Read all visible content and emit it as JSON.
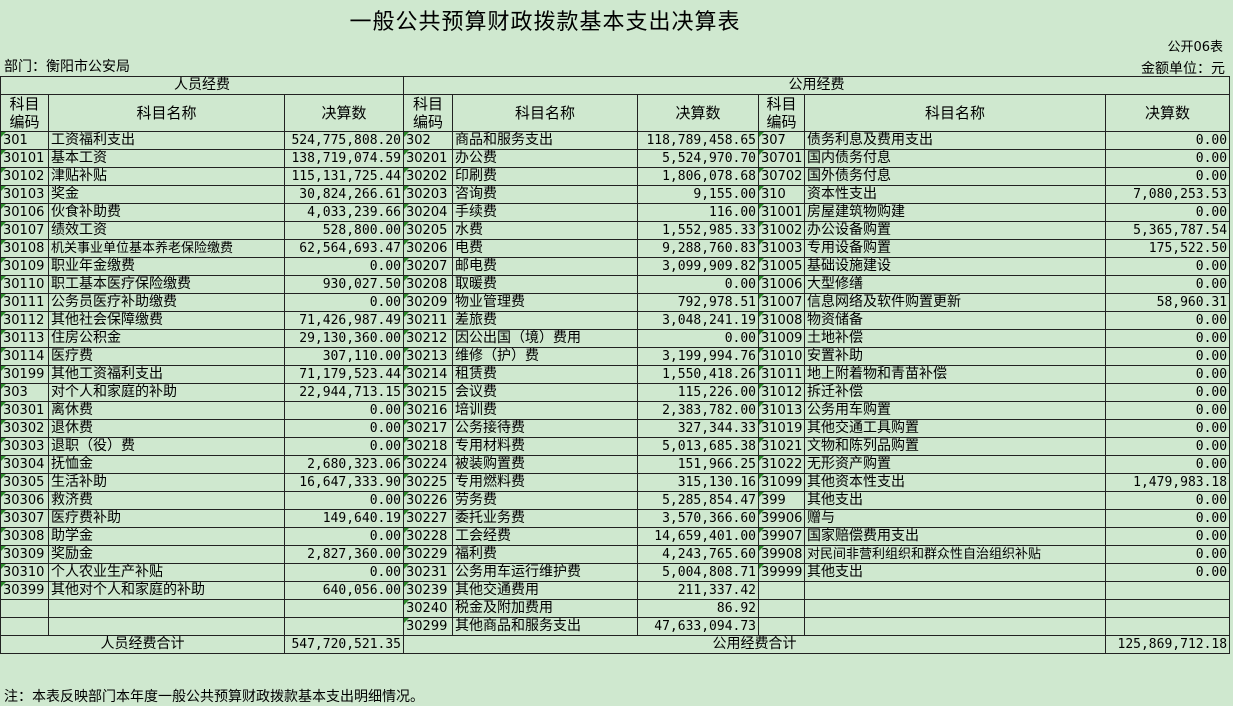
{
  "header": {
    "title": "一般公共预算财政拨款基本支出决算表",
    "form_no": "公开06表",
    "department": "部门：衡阳市公安局",
    "unit": "金额单位：元"
  },
  "sections": {
    "personnel": "人员经费",
    "public": "公用经费"
  },
  "columns": {
    "code": "科目编码",
    "name": "科目名称",
    "amount": "决算数"
  },
  "rows": [
    {
      "p": [
        "301",
        "工资福利支出",
        "524,775,808.20"
      ],
      "g": [
        "302",
        "商品和服务支出",
        "118,789,458.65"
      ],
      "r": [
        "307",
        "债务利息及费用支出",
        "0.00"
      ]
    },
    {
      "p": [
        "30101",
        "基本工资",
        "138,719,074.59"
      ],
      "g": [
        "30201",
        "办公费",
        "5,524,970.70"
      ],
      "r": [
        "30701",
        "国内债务付息",
        "0.00"
      ]
    },
    {
      "p": [
        "30102",
        "津贴补贴",
        "115,131,725.44"
      ],
      "g": [
        "30202",
        "印刷费",
        "1,806,078.68"
      ],
      "r": [
        "30702",
        "国外债务付息",
        "0.00"
      ]
    },
    {
      "p": [
        "30103",
        "奖金",
        "30,824,266.61"
      ],
      "g": [
        "30203",
        "咨询费",
        "9,155.00"
      ],
      "r": [
        "310",
        "资本性支出",
        "7,080,253.53"
      ]
    },
    {
      "p": [
        "30106",
        "伙食补助费",
        "4,033,239.66"
      ],
      "g": [
        "30204",
        "手续费",
        "116.00"
      ],
      "r": [
        "31001",
        "房屋建筑物购建",
        "0.00"
      ]
    },
    {
      "p": [
        "30107",
        "绩效工资",
        "528,800.00"
      ],
      "g": [
        "30205",
        "水费",
        "1,552,985.33"
      ],
      "r": [
        "31002",
        "办公设备购置",
        "5,365,787.54"
      ]
    },
    {
      "p": [
        "30108",
        "机关事业单位基本养老保险缴费",
        "62,564,693.47"
      ],
      "g": [
        "30206",
        "电费",
        "9,288,760.83"
      ],
      "r": [
        "31003",
        "专用设备购置",
        "175,522.50"
      ]
    },
    {
      "p": [
        "30109",
        "职业年金缴费",
        "0.00"
      ],
      "g": [
        "30207",
        "邮电费",
        "3,099,909.82"
      ],
      "r": [
        "31005",
        "基础设施建设",
        "0.00"
      ]
    },
    {
      "p": [
        "30110",
        "职工基本医疗保险缴费",
        "930,027.50"
      ],
      "g": [
        "30208",
        "取暖费",
        "0.00"
      ],
      "r": [
        "31006",
        "大型修缮",
        "0.00"
      ]
    },
    {
      "p": [
        "30111",
        "公务员医疗补助缴费",
        "0.00"
      ],
      "g": [
        "30209",
        "物业管理费",
        "792,978.51"
      ],
      "r": [
        "31007",
        "信息网络及软件购置更新",
        "58,960.31"
      ]
    },
    {
      "p": [
        "30112",
        "其他社会保障缴费",
        "71,426,987.49"
      ],
      "g": [
        "30211",
        "差旅费",
        "3,048,241.19"
      ],
      "r": [
        "31008",
        "物资储备",
        "0.00"
      ]
    },
    {
      "p": [
        "30113",
        "住房公积金",
        "29,130,360.00"
      ],
      "g": [
        "30212",
        "因公出国（境）费用",
        "0.00"
      ],
      "r": [
        "31009",
        "土地补偿",
        "0.00"
      ]
    },
    {
      "p": [
        "30114",
        "医疗费",
        "307,110.00"
      ],
      "g": [
        "30213",
        "维修（护）费",
        "3,199,994.76"
      ],
      "r": [
        "31010",
        "安置补助",
        "0.00"
      ]
    },
    {
      "p": [
        "30199",
        "其他工资福利支出",
        "71,179,523.44"
      ],
      "g": [
        "30214",
        "租赁费",
        "1,550,418.26"
      ],
      "r": [
        "31011",
        "地上附着物和青苗补偿",
        "0.00"
      ]
    },
    {
      "p": [
        "303",
        "对个人和家庭的补助",
        "22,944,713.15"
      ],
      "g": [
        "30215",
        "会议费",
        "115,226.00"
      ],
      "r": [
        "31012",
        "拆迁补偿",
        "0.00"
      ]
    },
    {
      "p": [
        "30301",
        "离休费",
        "0.00"
      ],
      "g": [
        "30216",
        "培训费",
        "2,383,782.00"
      ],
      "r": [
        "31013",
        "公务用车购置",
        "0.00"
      ]
    },
    {
      "p": [
        "30302",
        "退休费",
        "0.00"
      ],
      "g": [
        "30217",
        "公务接待费",
        "327,344.33"
      ],
      "r": [
        "31019",
        "其他交通工具购置",
        "0.00"
      ]
    },
    {
      "p": [
        "30303",
        "退职（役）费",
        "0.00"
      ],
      "g": [
        "30218",
        "专用材料费",
        "5,013,685.38"
      ],
      "r": [
        "31021",
        "文物和陈列品购置",
        "0.00"
      ]
    },
    {
      "p": [
        "30304",
        "抚恤金",
        "2,680,323.06"
      ],
      "g": [
        "30224",
        "被装购置费",
        "151,966.25"
      ],
      "r": [
        "31022",
        "无形资产购置",
        "0.00"
      ]
    },
    {
      "p": [
        "30305",
        "生活补助",
        "16,647,333.90"
      ],
      "g": [
        "30225",
        "专用燃料费",
        "315,130.16"
      ],
      "r": [
        "31099",
        "其他资本性支出",
        "1,479,983.18"
      ]
    },
    {
      "p": [
        "30306",
        "救济费",
        "0.00"
      ],
      "g": [
        "30226",
        "劳务费",
        "5,285,854.47"
      ],
      "r": [
        "399",
        "其他支出",
        "0.00"
      ]
    },
    {
      "p": [
        "30307",
        "医疗费补助",
        "149,640.19"
      ],
      "g": [
        "30227",
        "委托业务费",
        "3,570,366.60"
      ],
      "r": [
        "39906",
        "赠与",
        "0.00"
      ]
    },
    {
      "p": [
        "30308",
        "助学金",
        "0.00"
      ],
      "g": [
        "30228",
        "工会经费",
        "14,659,401.00"
      ],
      "r": [
        "39907",
        "国家赔偿费用支出",
        "0.00"
      ]
    },
    {
      "p": [
        "30309",
        "奖励金",
        "2,827,360.00"
      ],
      "g": [
        "30229",
        "福利费",
        "4,243,765.60"
      ],
      "r": [
        "39908",
        "对民间非营利组织和群众性自治组织补贴",
        "0.00"
      ]
    },
    {
      "p": [
        "30310",
        "个人农业生产补贴",
        "0.00"
      ],
      "g": [
        "30231",
        "公务用车运行维护费",
        "5,004,808.71"
      ],
      "r": [
        "39999",
        "其他支出",
        "0.00"
      ]
    },
    {
      "p": [
        "30399",
        "其他对个人和家庭的补助",
        "640,056.00"
      ],
      "g": [
        "30239",
        "其他交通费用",
        "211,337.42"
      ],
      "r": [
        "",
        "",
        ""
      ]
    },
    {
      "p": [
        "",
        "",
        ""
      ],
      "g": [
        "30240",
        "税金及附加费用",
        "86.92"
      ],
      "r": [
        "",
        "",
        ""
      ]
    },
    {
      "p": [
        "",
        "",
        ""
      ],
      "g": [
        "30299",
        "其他商品和服务支出",
        "47,633,094.73"
      ],
      "r": [
        "",
        "",
        ""
      ]
    }
  ],
  "totals": {
    "personnel_label": "人员经费合计",
    "personnel_value": "547,720,521.35",
    "public_label": "公用经费合计",
    "public_value": "125,869,712.18"
  },
  "note": "注：本表反映部门本年度一般公共预算财政拨款基本支出明细情况。"
}
